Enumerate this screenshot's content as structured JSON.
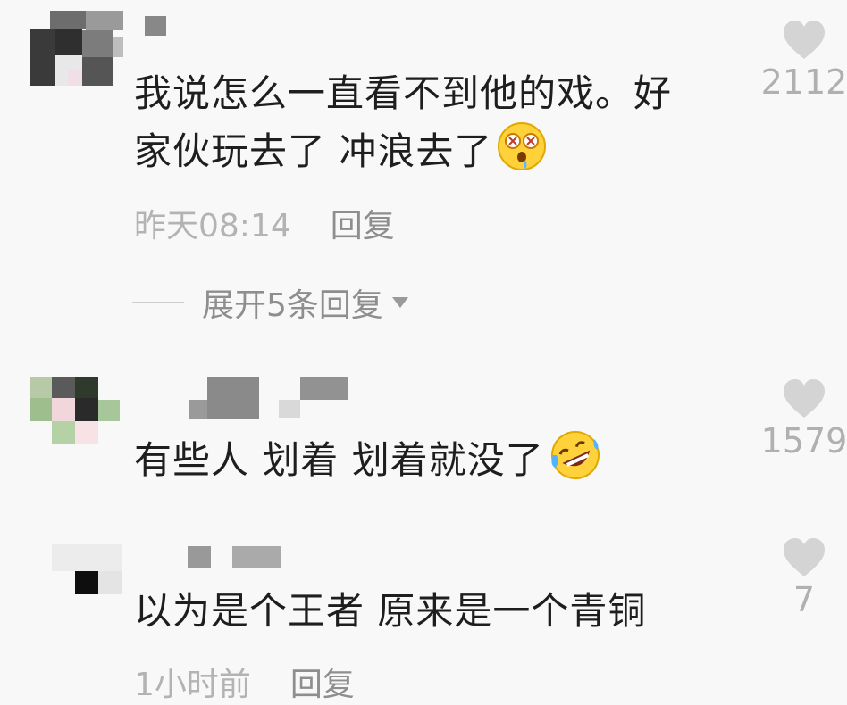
{
  "comments": [
    {
      "text_lines": [
        "我说怎么一直看不到他的戏。好",
        "家伙玩去了 冲浪去了"
      ],
      "emoji": "dizzy-face-emoji",
      "time": "昨天08:14",
      "reply": "回复",
      "likes": "2112",
      "expand": "展开5条回复"
    },
    {
      "text_lines": [
        "有些人 划着 划着就没了"
      ],
      "emoji": "rofl-emoji",
      "likes": "1579"
    },
    {
      "text_lines": [
        "以为是个王者 原来是一个青铜"
      ],
      "time": "1小时前",
      "reply": "回复",
      "likes": "7"
    }
  ],
  "colors": {
    "text": "#1e1e1e",
    "meta": "#b3b3b3",
    "heart": "#d4d4d4"
  }
}
